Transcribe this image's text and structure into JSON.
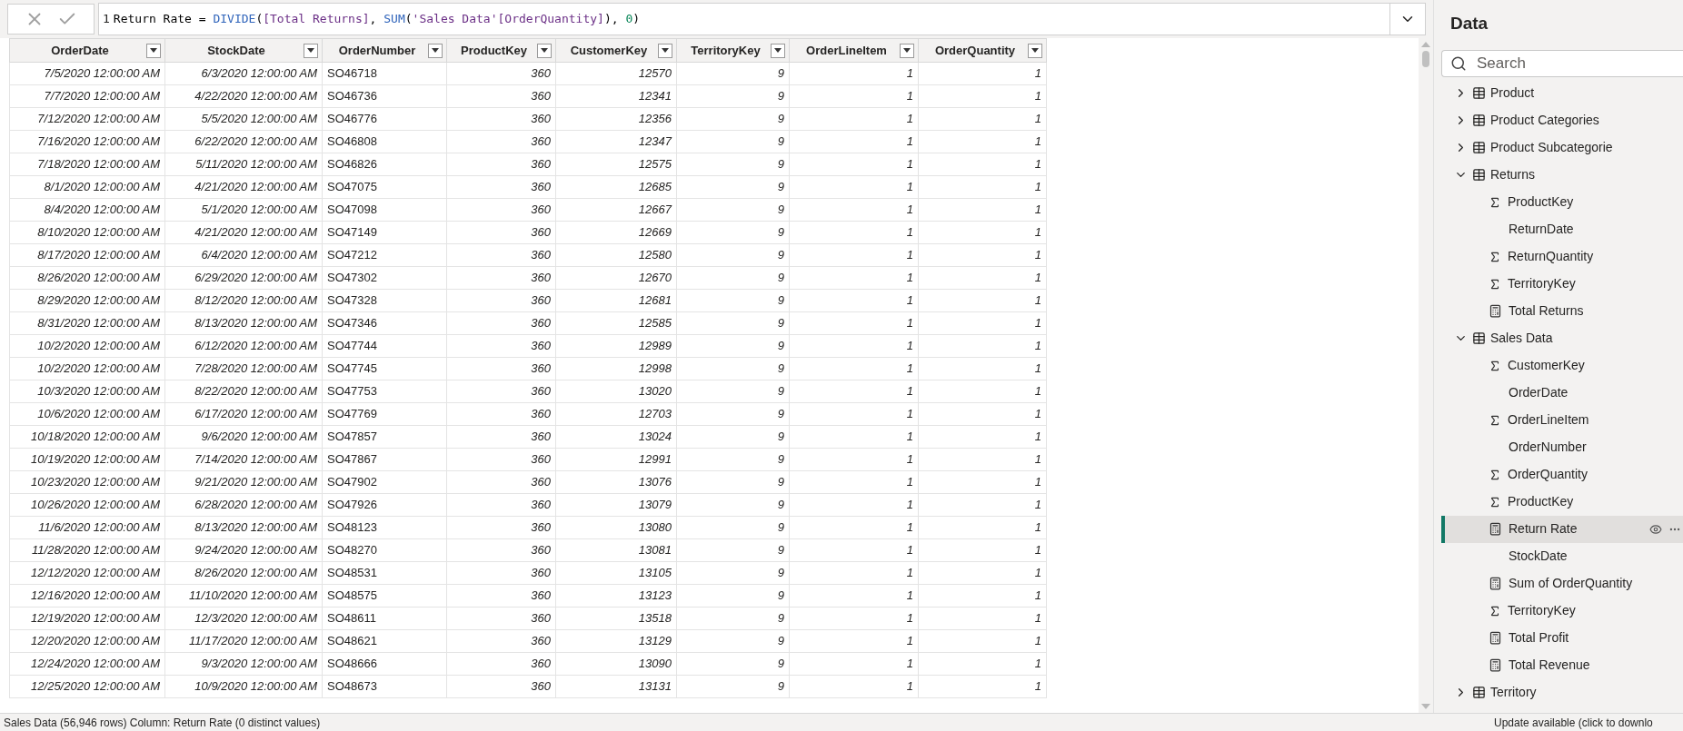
{
  "formula_bar": {
    "line_number": "1",
    "tokens": [
      {
        "kind": "plain",
        "text": "Return Rate = "
      },
      {
        "kind": "function",
        "text": "DIVIDE"
      },
      {
        "kind": "plain",
        "text": "("
      },
      {
        "kind": "reference",
        "text": "[Total Returns]"
      },
      {
        "kind": "plain",
        "text": ", "
      },
      {
        "kind": "function",
        "text": "SUM"
      },
      {
        "kind": "plain",
        "text": "("
      },
      {
        "kind": "reference",
        "text": "'Sales Data'[OrderQuantity]"
      },
      {
        "kind": "plain",
        "text": "), "
      },
      {
        "kind": "number",
        "text": "0"
      },
      {
        "kind": "plain",
        "text": ")"
      }
    ]
  },
  "table": {
    "columns": [
      {
        "label": "OrderDate",
        "kind": "date"
      },
      {
        "label": "StockDate",
        "kind": "date"
      },
      {
        "label": "OrderNumber",
        "kind": "text"
      },
      {
        "label": "ProductKey",
        "kind": "number"
      },
      {
        "label": "CustomerKey",
        "kind": "number"
      },
      {
        "label": "TerritoryKey",
        "kind": "number"
      },
      {
        "label": "OrderLineItem",
        "kind": "number"
      },
      {
        "label": "OrderQuantity",
        "kind": "number"
      }
    ],
    "rows": [
      [
        "7/5/2020 12:00:00 AM",
        "6/3/2020 12:00:00 AM",
        "SO46718",
        "360",
        "12570",
        "9",
        "1",
        "1"
      ],
      [
        "7/7/2020 12:00:00 AM",
        "4/22/2020 12:00:00 AM",
        "SO46736",
        "360",
        "12341",
        "9",
        "1",
        "1"
      ],
      [
        "7/12/2020 12:00:00 AM",
        "5/5/2020 12:00:00 AM",
        "SO46776",
        "360",
        "12356",
        "9",
        "1",
        "1"
      ],
      [
        "7/16/2020 12:00:00 AM",
        "6/22/2020 12:00:00 AM",
        "SO46808",
        "360",
        "12347",
        "9",
        "1",
        "1"
      ],
      [
        "7/18/2020 12:00:00 AM",
        "5/11/2020 12:00:00 AM",
        "SO46826",
        "360",
        "12575",
        "9",
        "1",
        "1"
      ],
      [
        "8/1/2020 12:00:00 AM",
        "4/21/2020 12:00:00 AM",
        "SO47075",
        "360",
        "12685",
        "9",
        "1",
        "1"
      ],
      [
        "8/4/2020 12:00:00 AM",
        "5/1/2020 12:00:00 AM",
        "SO47098",
        "360",
        "12667",
        "9",
        "1",
        "1"
      ],
      [
        "8/10/2020 12:00:00 AM",
        "4/21/2020 12:00:00 AM",
        "SO47149",
        "360",
        "12669",
        "9",
        "1",
        "1"
      ],
      [
        "8/17/2020 12:00:00 AM",
        "6/4/2020 12:00:00 AM",
        "SO47212",
        "360",
        "12580",
        "9",
        "1",
        "1"
      ],
      [
        "8/26/2020 12:00:00 AM",
        "6/29/2020 12:00:00 AM",
        "SO47302",
        "360",
        "12670",
        "9",
        "1",
        "1"
      ],
      [
        "8/29/2020 12:00:00 AM",
        "8/12/2020 12:00:00 AM",
        "SO47328",
        "360",
        "12681",
        "9",
        "1",
        "1"
      ],
      [
        "8/31/2020 12:00:00 AM",
        "8/13/2020 12:00:00 AM",
        "SO47346",
        "360",
        "12585",
        "9",
        "1",
        "1"
      ],
      [
        "10/2/2020 12:00:00 AM",
        "6/12/2020 12:00:00 AM",
        "SO47744",
        "360",
        "12989",
        "9",
        "1",
        "1"
      ],
      [
        "10/2/2020 12:00:00 AM",
        "7/28/2020 12:00:00 AM",
        "SO47745",
        "360",
        "12998",
        "9",
        "1",
        "1"
      ],
      [
        "10/3/2020 12:00:00 AM",
        "8/22/2020 12:00:00 AM",
        "SO47753",
        "360",
        "13020",
        "9",
        "1",
        "1"
      ],
      [
        "10/6/2020 12:00:00 AM",
        "6/17/2020 12:00:00 AM",
        "SO47769",
        "360",
        "12703",
        "9",
        "1",
        "1"
      ],
      [
        "10/18/2020 12:00:00 AM",
        "9/6/2020 12:00:00 AM",
        "SO47857",
        "360",
        "13024",
        "9",
        "1",
        "1"
      ],
      [
        "10/19/2020 12:00:00 AM",
        "7/14/2020 12:00:00 AM",
        "SO47867",
        "360",
        "12991",
        "9",
        "1",
        "1"
      ],
      [
        "10/23/2020 12:00:00 AM",
        "9/21/2020 12:00:00 AM",
        "SO47902",
        "360",
        "13076",
        "9",
        "1",
        "1"
      ],
      [
        "10/26/2020 12:00:00 AM",
        "6/28/2020 12:00:00 AM",
        "SO47926",
        "360",
        "13079",
        "9",
        "1",
        "1"
      ],
      [
        "11/6/2020 12:00:00 AM",
        "8/13/2020 12:00:00 AM",
        "SO48123",
        "360",
        "13080",
        "9",
        "1",
        "1"
      ],
      [
        "11/28/2020 12:00:00 AM",
        "9/24/2020 12:00:00 AM",
        "SO48270",
        "360",
        "13081",
        "9",
        "1",
        "1"
      ],
      [
        "12/12/2020 12:00:00 AM",
        "8/26/2020 12:00:00 AM",
        "SO48531",
        "360",
        "13105",
        "9",
        "1",
        "1"
      ],
      [
        "12/16/2020 12:00:00 AM",
        "11/10/2020 12:00:00 AM",
        "SO48575",
        "360",
        "13123",
        "9",
        "1",
        "1"
      ],
      [
        "12/19/2020 12:00:00 AM",
        "12/3/2020 12:00:00 AM",
        "SO48611",
        "360",
        "13518",
        "9",
        "1",
        "1"
      ],
      [
        "12/20/2020 12:00:00 AM",
        "11/17/2020 12:00:00 AM",
        "SO48621",
        "360",
        "13129",
        "9",
        "1",
        "1"
      ],
      [
        "12/24/2020 12:00:00 AM",
        "9/3/2020 12:00:00 AM",
        "SO48666",
        "360",
        "13090",
        "9",
        "1",
        "1"
      ],
      [
        "12/25/2020 12:00:00 AM",
        "10/9/2020 12:00:00 AM",
        "SO48673",
        "360",
        "13131",
        "9",
        "1",
        "1"
      ]
    ]
  },
  "data_pane": {
    "title": "Data",
    "search": {
      "placeholder": "Search"
    },
    "tables": [
      {
        "name": "Product",
        "expanded": false,
        "selected": false
      },
      {
        "name": "Product Categories",
        "expanded": false,
        "selected": false
      },
      {
        "name": "Product Subcategorie",
        "expanded": false,
        "selected": false
      },
      {
        "name": "Returns",
        "expanded": true,
        "selected": false,
        "children": [
          {
            "name": "ProductKey",
            "kind": "sum",
            "selected": false
          },
          {
            "name": "ReturnDate",
            "kind": "plain",
            "selected": false
          },
          {
            "name": "ReturnQuantity",
            "kind": "sum",
            "selected": false
          },
          {
            "name": "TerritoryKey",
            "kind": "sum",
            "selected": false
          },
          {
            "name": "Total Returns",
            "kind": "measure",
            "selected": false
          }
        ]
      },
      {
        "name": "Sales Data",
        "expanded": true,
        "selected": false,
        "children": [
          {
            "name": "CustomerKey",
            "kind": "sum",
            "selected": false
          },
          {
            "name": "OrderDate",
            "kind": "plain",
            "selected": false
          },
          {
            "name": "OrderLineItem",
            "kind": "sum",
            "selected": false
          },
          {
            "name": "OrderNumber",
            "kind": "plain",
            "selected": false
          },
          {
            "name": "OrderQuantity",
            "kind": "sum",
            "selected": false
          },
          {
            "name": "ProductKey",
            "kind": "sum",
            "selected": false
          },
          {
            "name": "Return Rate",
            "kind": "measure",
            "selected": true
          },
          {
            "name": "StockDate",
            "kind": "plain",
            "selected": false
          },
          {
            "name": "Sum of OrderQuantity",
            "kind": "measure",
            "selected": false
          },
          {
            "name": "TerritoryKey",
            "kind": "sum",
            "selected": false
          },
          {
            "name": "Total Profit",
            "kind": "measure",
            "selected": false
          },
          {
            "name": "Total Revenue",
            "kind": "measure",
            "selected": false
          }
        ]
      },
      {
        "name": "Territory",
        "expanded": false,
        "selected": false
      }
    ]
  },
  "status_bar": {
    "left": "Sales Data (56,946 rows) Column: Return Rate (0 distinct values)",
    "right": "Update available (click to downlo"
  }
}
